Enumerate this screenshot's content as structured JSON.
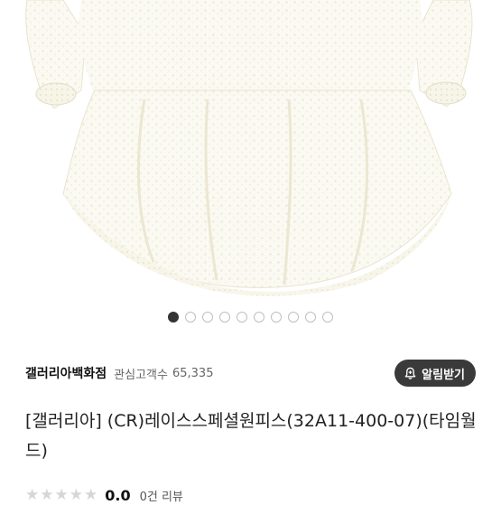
{
  "product": {
    "image_alt": "white lace dress",
    "carousel": {
      "total": 10,
      "active": 0
    },
    "seller": {
      "name": "갤러리아백화점",
      "follower_label": "관심고객수",
      "follower_count": "65,335",
      "alarm_button": "알림받기"
    },
    "title": "[갤러리아] (CR)레이스스페셜원피스(32A11-400-07)(타임월드)",
    "rating": {
      "stars": 5,
      "filled": 0,
      "score": "0.0",
      "review_count": "0건 리뷰"
    }
  },
  "colors": {
    "star_empty": "#d6d6d6",
    "button_bg": "#3a3a3a",
    "dot_active": "#333333"
  }
}
